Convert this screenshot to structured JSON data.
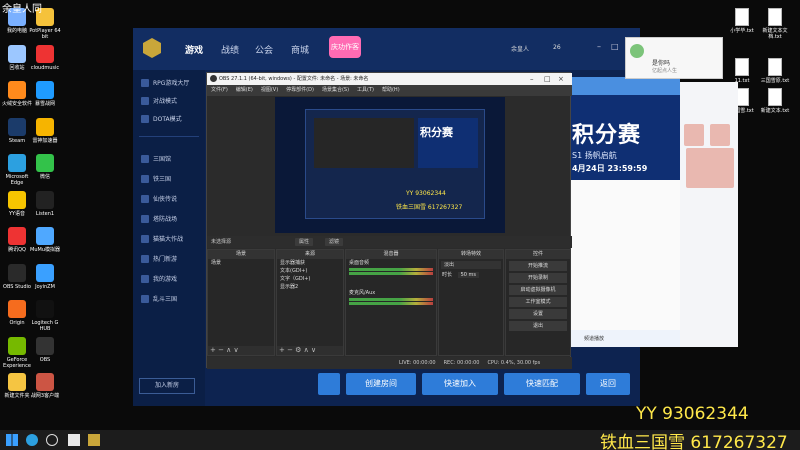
{
  "overlay": {
    "yy": "YY 93062344",
    "tie": "铁血三国雪 617267327",
    "corner": "余皇人同"
  },
  "desktop_left": [
    {
      "label": "我的电脑",
      "icon": "computer-icon",
      "color": "#7ab0ff"
    },
    {
      "label": "PotPlayer 64 bit",
      "icon": "potplayer-icon",
      "color": "#f5c23b"
    },
    {
      "label": "回收站",
      "icon": "recycle-bin-icon",
      "color": "#9cc7ff"
    },
    {
      "label": "cloudmusic",
      "icon": "cloudmusic-icon",
      "color": "#e33"
    },
    {
      "label": "火绒安全软件",
      "icon": "huorong-icon",
      "color": "#ff8a1c"
    },
    {
      "label": "暴雪战网",
      "icon": "battlenet-icon",
      "color": "#1f9bff"
    },
    {
      "label": "Steam",
      "icon": "steam-icon",
      "color": "#1b3b6a"
    },
    {
      "label": "雷神加速器",
      "icon": "leishen-icon",
      "color": "#f6b400"
    },
    {
      "label": "Microsoft Edge",
      "icon": "edge-icon",
      "color": "#2ca0e0"
    },
    {
      "label": "微信",
      "icon": "wechat-icon",
      "color": "#33c24a"
    },
    {
      "label": "YY语音",
      "icon": "yy-icon",
      "color": "#f6c400"
    },
    {
      "label": "Listen1",
      "icon": "listen1-icon",
      "color": "#222"
    },
    {
      "label": "腾讯QQ",
      "icon": "qq-icon",
      "color": "#e33"
    },
    {
      "label": "MuMu模拟器",
      "icon": "mumu-icon",
      "color": "#4fa8ff"
    },
    {
      "label": "OBS Studio",
      "icon": "obs-icon",
      "color": "#2a2a2a"
    },
    {
      "label": "JoyinZM",
      "icon": "joyin-icon",
      "color": "#3aa0ff"
    },
    {
      "label": "Origin",
      "icon": "origin-icon",
      "color": "#f56c1e"
    },
    {
      "label": "Logitech G HUB",
      "icon": "logitech-icon",
      "color": "#111"
    },
    {
      "label": "GeForce Experience",
      "icon": "geforce-icon",
      "color": "#76b900"
    },
    {
      "label": "OBS",
      "icon": "obs-shortcut-icon",
      "color": "#333"
    },
    {
      "label": "新建文件夹",
      "icon": "folder-icon",
      "color": "#f5c542"
    },
    {
      "label": "战网3客户端",
      "icon": "battlenet-client-icon",
      "color": "#c54"
    }
  ],
  "desktop_right": [
    {
      "label": "小学毕.txt"
    },
    {
      "label": "新建文本文档.txt"
    },
    {
      "label": "11.txt"
    },
    {
      "label": "三国雪原.txt"
    },
    {
      "label": "三国雪.txt"
    },
    {
      "label": "新建文本.txt"
    }
  ],
  "launcher": {
    "nav": [
      "游戏",
      "战绩",
      "公会",
      "商城"
    ],
    "banner": "庆功作客",
    "user": "余皇人",
    "level": "26",
    "sidebar": [
      "RPG游戏大厅",
      "对战模式",
      "DOTA模式",
      "三国馆",
      "铁三国",
      "仙侠传说",
      "塔防战场",
      "猫猫大作战",
      "热门新游",
      "我的游戏",
      "乱斗三国"
    ],
    "room_button": "加入新房",
    "bottom": {
      "create": "创建房间",
      "quick_join": "快速加入",
      "quick_match": "快速匹配",
      "back": "返回"
    }
  },
  "tour": {
    "big": "积分赛",
    "sub": "S1 扬帆启航",
    "date": "4月24日 23:59:59",
    "foot": "频道播放"
  },
  "contact": {
    "name": "是你吗",
    "sub": "亿起点人生"
  },
  "obs": {
    "title": "OBS 27.1.1 (64-bit, windows) - 配置文件: 未命名 - 场景: 未命名",
    "menu": [
      "文件(F)",
      "编辑(E)",
      "视图(V)",
      "停靠部件(D)",
      "场景集合(S)",
      "工具(T)",
      "帮助(H)"
    ],
    "no_source": "未选择源",
    "props": "属性",
    "filters": "滤镜",
    "docks": {
      "scenes": {
        "title": "场景",
        "items": [
          "场景"
        ]
      },
      "sources": {
        "title": "来源",
        "items": [
          "显示器捕获",
          "文本(GDI+)",
          "文字（GDI+)",
          "显示器2"
        ]
      },
      "mixer": {
        "title": "混音器",
        "items": [
          "桌面音频",
          "麦克风/Aux"
        ]
      },
      "transitions": {
        "title": "转场特效",
        "fade": "淡出",
        "duration_label": "时长",
        "duration": "50 ms"
      },
      "controls": {
        "title": "控件",
        "buttons": [
          "开始推流",
          "开始录制",
          "启动虚拟摄像机",
          "工作室模式",
          "设置",
          "退出"
        ]
      }
    },
    "status": {
      "live": "LIVE: 00:00:00",
      "rec": "REC: 00:00:00",
      "cpu": "CPU: 0.4%, 30.00 fps"
    },
    "preview": {
      "big": "积分赛",
      "yy": "YY 93062344",
      "tie": "铁血三国雪 617267327"
    }
  }
}
